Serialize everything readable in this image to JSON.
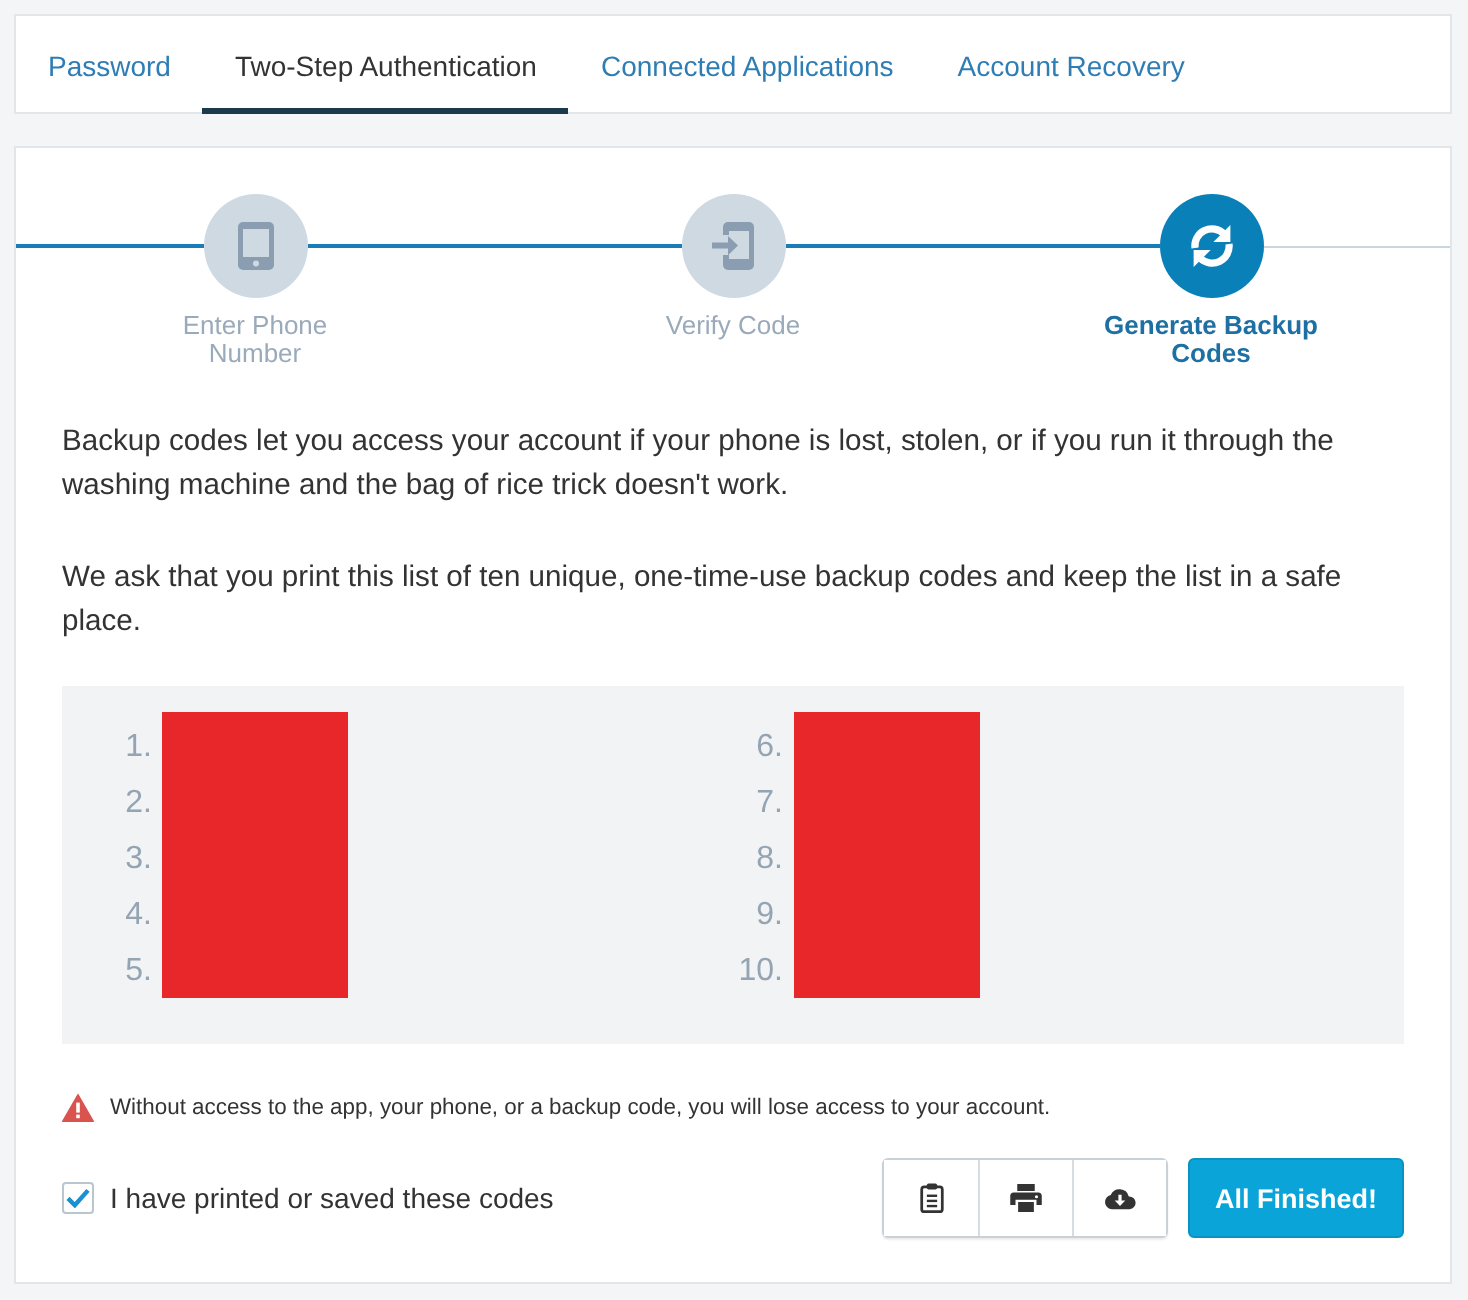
{
  "tabs": [
    {
      "label": "Password",
      "selected": false
    },
    {
      "label": "Two-Step Authentication",
      "selected": true
    },
    {
      "label": "Connected Applications",
      "selected": false
    },
    {
      "label": "Account Recovery",
      "selected": false
    }
  ],
  "steps": [
    {
      "kind": "phone",
      "label": "Enter Phone Number",
      "selected": false
    },
    {
      "kind": "verify",
      "label": "Verify Code",
      "selected": false
    },
    {
      "kind": "refresh",
      "label": "Generate Backup Codes",
      "selected": true
    }
  ],
  "intro": [
    "Backup codes let you access your account if your phone is lost, stolen, or if you run it through the washing machine and the bag of rice trick doesn't work.",
    "We ask that you print this list of ten unique, one-time-use backup codes and keep the list in a safe place."
  ],
  "backup_codes": {
    "columns": [
      {
        "numbers": [
          "1.",
          "2.",
          "3.",
          "4.",
          "5."
        ],
        "redacted": true
      },
      {
        "numbers": [
          "6.",
          "7.",
          "8.",
          "9.",
          "10."
        ],
        "redacted": true
      }
    ]
  },
  "warning": {
    "text": "Without access to the app, your phone, or a backup code, you will lose access to your account."
  },
  "confirm": {
    "label": "I have printed or saved these codes",
    "checked": true
  },
  "icon_buttons": [
    {
      "kind": "clipboard"
    },
    {
      "kind": "print"
    },
    {
      "kind": "download"
    }
  ],
  "finish_button": {
    "label": "All Finished!"
  }
}
